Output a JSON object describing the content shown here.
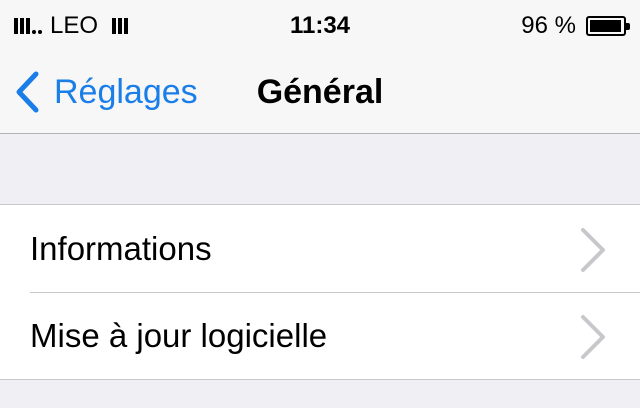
{
  "status_bar": {
    "carrier": "LEO",
    "time": "11:34",
    "battery_text": "96 %",
    "battery_level": 0.96
  },
  "nav": {
    "back_label": "Réglages",
    "title": "Général"
  },
  "settings_rows": [
    {
      "label": "Informations",
      "icon": "chevron-right-icon"
    },
    {
      "label": "Mise à jour logicielle",
      "icon": "chevron-right-icon"
    }
  ],
  "colors": {
    "accent": "#1a7ee8",
    "background": "#efeff4",
    "separator": "#c8c7cc",
    "disclosure": "#c7c7cc"
  }
}
